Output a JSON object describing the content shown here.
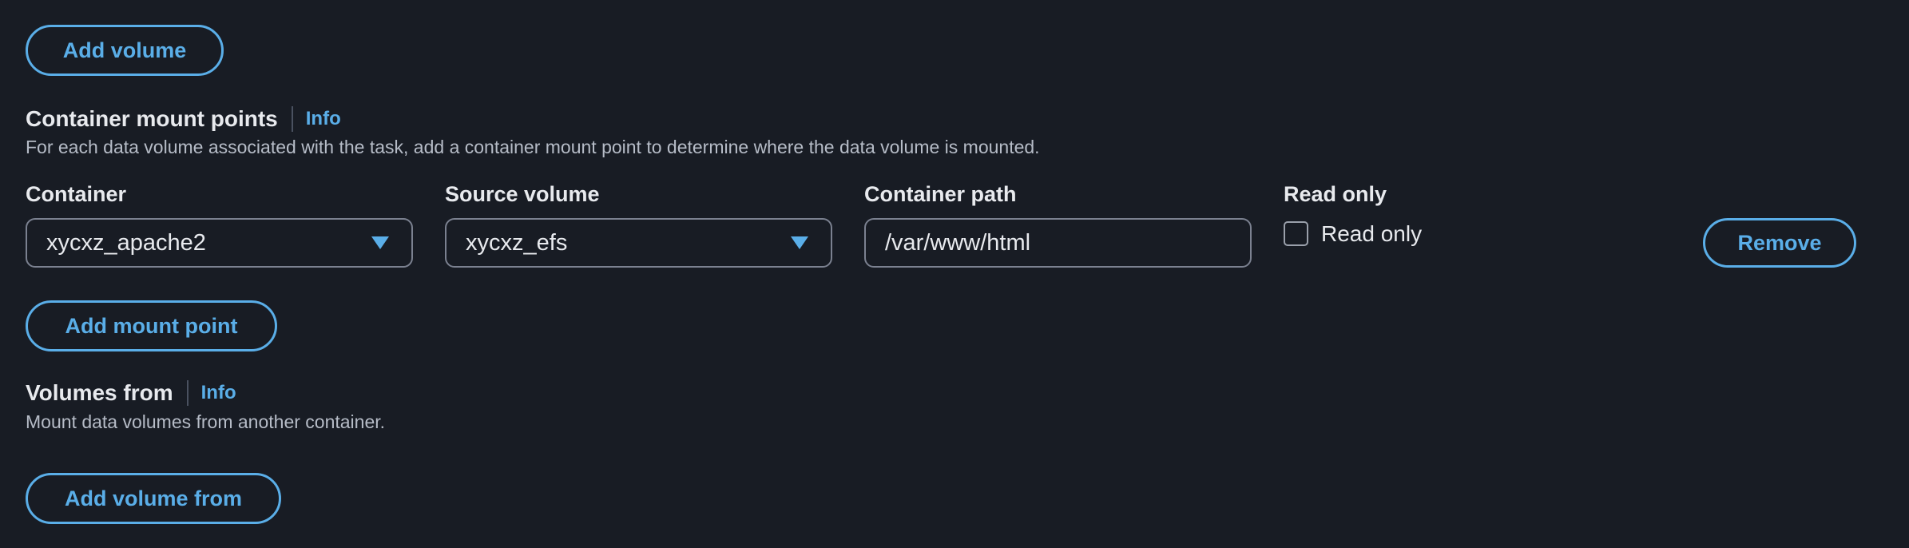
{
  "buttons": {
    "add_volume": "Add volume",
    "add_mount_point": "Add mount point",
    "add_volume_from": "Add volume from",
    "remove": "Remove"
  },
  "mount_points": {
    "title": "Container mount points",
    "info": "Info",
    "description": "For each data volume associated with the task, add a container mount point to determine where the data volume is mounted.",
    "row": {
      "container_label": "Container",
      "container_value": "xycxz_apache2",
      "source_label": "Source volume",
      "source_value": "xycxz_efs",
      "path_label": "Container path",
      "path_value": "/var/www/html",
      "readonly_label": "Read only",
      "readonly_checkbox_label": "Read only",
      "readonly_checked": false
    }
  },
  "volumes_from": {
    "title": "Volumes from",
    "info": "Info",
    "description": "Mount data volumes from another container."
  },
  "colors": {
    "background": "#181c24",
    "accent": "#5aaee8",
    "text": "#e8eaee",
    "muted_text": "#b6bcc7",
    "border": "#7b8190"
  },
  "icons": {
    "dropdown": "caret-down-icon"
  }
}
